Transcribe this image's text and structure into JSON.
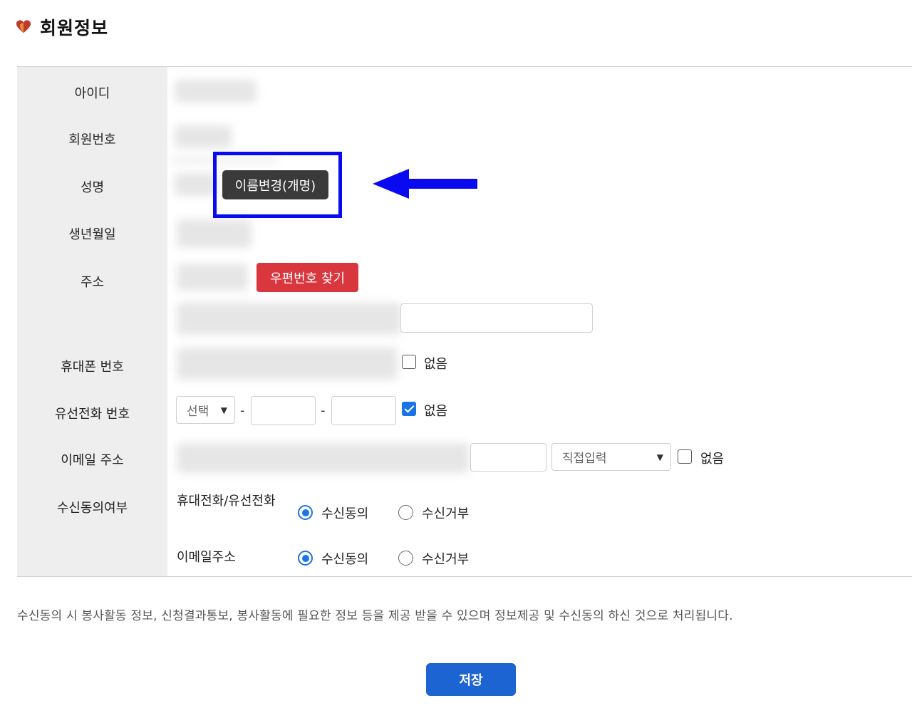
{
  "header": {
    "title": "회원정보",
    "icon": "heart-icon",
    "icon_color": "#c0392b"
  },
  "labels": {
    "id": "아이디",
    "member_no": "회원번호",
    "name": "성명",
    "birth": "생년월일",
    "address": "주소",
    "mobile": "휴대폰 번호",
    "phone": "유선전화 번호",
    "email": "이메일 주소",
    "consent": "수신동의여부"
  },
  "buttons": {
    "rename": "이름변경(개명)",
    "zip_search": "우편번호 찾기",
    "save": "저장"
  },
  "mobile": {
    "none_label": "없음",
    "none_checked": false
  },
  "phone": {
    "area_select": "선택",
    "dash": "-",
    "none_label": "없음",
    "none_checked": true
  },
  "email": {
    "domain_select": "직접입력",
    "none_label": "없음",
    "none_checked": false
  },
  "consent": {
    "phone_label": "휴대전화/유선전화",
    "email_label": "이메일주소",
    "agree_label": "수신동의",
    "reject_label": "수신거부",
    "phone_value": "수신동의",
    "email_value": "수신동의"
  },
  "notice": "수신동의 시 봉사활동 정보, 신청결과통보, 봉사활동에 필요한 정보 등을 제공 받을 수 있으며 정보제공 및 수신동의 하신 것으로 처리됩니다.",
  "colors": {
    "highlight": "#0a0af0",
    "zip_button": "#d9363e",
    "save_button": "#1b64d1",
    "rename_button": "#3a3a3a"
  }
}
